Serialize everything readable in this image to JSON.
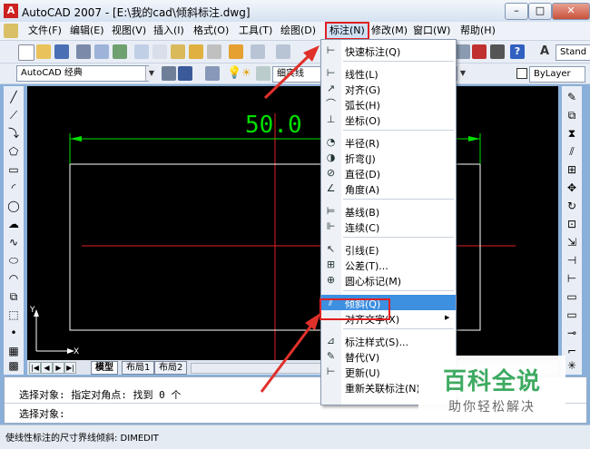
{
  "window": {
    "title": "AutoCAD 2007 - [E:\\我的cad\\倾斜标注.dwg]",
    "app_icon": "autocad-logo-icon",
    "min_label": "–",
    "max_label": "□",
    "close_label": "✕"
  },
  "menu": {
    "items": [
      "文件(F)",
      "编辑(E)",
      "视图(V)",
      "插入(I)",
      "格式(O)",
      "工具(T)",
      "绘图(D)",
      "标注(N)",
      "修改(M)",
      "窗口(W)",
      "帮助(H)"
    ],
    "active_index": 7
  },
  "toolbar": {
    "workspace_value": "AutoCAD 经典",
    "layer_combo_value": "ByLayer",
    "style_combo_value": "Stand",
    "layer_label": "细实线"
  },
  "canvas": {
    "dimension_text": "50.0",
    "ucs_x_label": "X",
    "ucs_y_label": "Y",
    "colors": {
      "background": "#000000",
      "dimension": "#00e000",
      "centerline": "#e02020",
      "geometry": "#ffffff"
    }
  },
  "tabs": {
    "items": [
      "模型",
      "布局1",
      "布局2"
    ],
    "active_index": 0
  },
  "command": {
    "line1": "选择对象: 指定对角点: 找到 0 个",
    "line2": "选择对象:"
  },
  "status": {
    "text": "使线性标注的尺寸界线倾斜:  DIMEDIT"
  },
  "dim_menu": {
    "groups": [
      [
        {
          "label": "快速标注(Q)",
          "icon": "quick-dimension-icon",
          "glyph": "⊢"
        }
      ],
      [
        {
          "label": "线性(L)",
          "icon": "linear-dimension-icon",
          "glyph": "⊢"
        },
        {
          "label": "对齐(G)",
          "icon": "aligned-dimension-icon",
          "glyph": "↗"
        },
        {
          "label": "弧长(H)",
          "icon": "arc-length-icon",
          "glyph": "⌒"
        },
        {
          "label": "坐标(O)",
          "icon": "ordinate-icon",
          "glyph": "⊥"
        }
      ],
      [
        {
          "label": "半径(R)",
          "icon": "radius-icon",
          "glyph": "◔"
        },
        {
          "label": "折弯(J)",
          "icon": "jogged-icon",
          "glyph": "◑"
        },
        {
          "label": "直径(D)",
          "icon": "diameter-icon",
          "glyph": "⊘"
        },
        {
          "label": "角度(A)",
          "icon": "angular-icon",
          "glyph": "∠"
        }
      ],
      [
        {
          "label": "基线(B)",
          "icon": "baseline-icon",
          "glyph": "⊨"
        },
        {
          "label": "连续(C)",
          "icon": "continue-icon",
          "glyph": "⊩"
        }
      ],
      [
        {
          "label": "引线(E)",
          "icon": "leader-icon",
          "glyph": "↖"
        },
        {
          "label": "公差(T)...",
          "icon": "tolerance-icon",
          "glyph": "⊞"
        },
        {
          "label": "圆心标记(M)",
          "icon": "center-mark-icon",
          "glyph": "⊕"
        }
      ],
      [
        {
          "label": "倾斜(Q)",
          "icon": "oblique-icon",
          "glyph": "⫽",
          "highlighted": true
        },
        {
          "label": "对齐文字(X)",
          "icon": "",
          "glyph": "",
          "submenu": true
        }
      ],
      [
        {
          "label": "标注样式(S)...",
          "icon": "dimension-style-icon",
          "glyph": "⊿"
        },
        {
          "label": "替代(V)",
          "icon": "override-icon",
          "glyph": "✎"
        },
        {
          "label": "更新(U)",
          "icon": "update-icon",
          "glyph": "⊢"
        },
        {
          "label": "重新关联标注(N)",
          "icon": "",
          "glyph": ""
        }
      ]
    ]
  },
  "watermark": {
    "main": "百科全说",
    "sub": "助你轻松解决"
  }
}
